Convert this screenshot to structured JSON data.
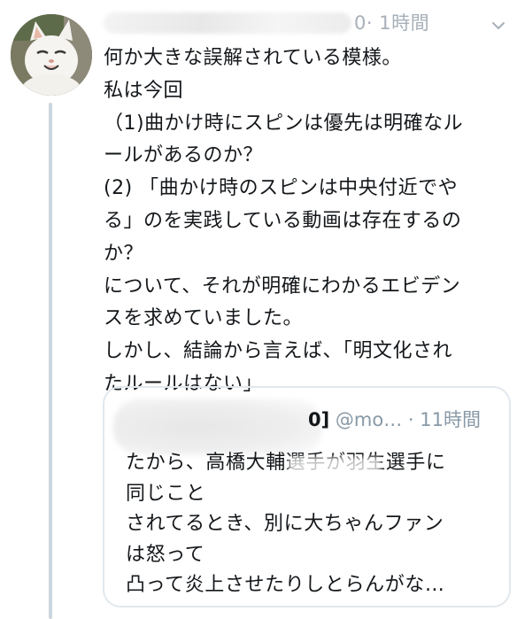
{
  "tweet": {
    "handle_tail": "0",
    "timestamp": "· 1時間",
    "lines": [
      "何か大きな誤解されている模様。",
      "私は今回",
      "（1)曲かけ時にスピンは優先は明確なル",
      "ールがあるのか？",
      "(2) 「曲かけ時のスピンは中央付近でや",
      "る」のを実践している動画は存在するの",
      "か？",
      "について、それが明確にわかるエビデン",
      "スを求めていました。",
      "しかし、結論から言えば、「明文化され",
      "たルールはない」"
    ]
  },
  "quote": {
    "name_tail": "0]",
    "handle": "@mo…",
    "timestamp": "· 11時間",
    "lines": [
      "たから、高橋大輔選手が羽生選手に",
      "同じこと",
      "されてるとき、別に大ちゃんファン",
      "は怒って",
      "凸って炎上させたりしとらんがな…"
    ]
  },
  "icons": {
    "avatar": "cat-avatar",
    "menu": "chevron-down-icon"
  },
  "colors": {
    "text": "#14171a",
    "muted": "#8899a6",
    "border": "#e1e8ed",
    "thread_line": "#cdd6dd"
  }
}
